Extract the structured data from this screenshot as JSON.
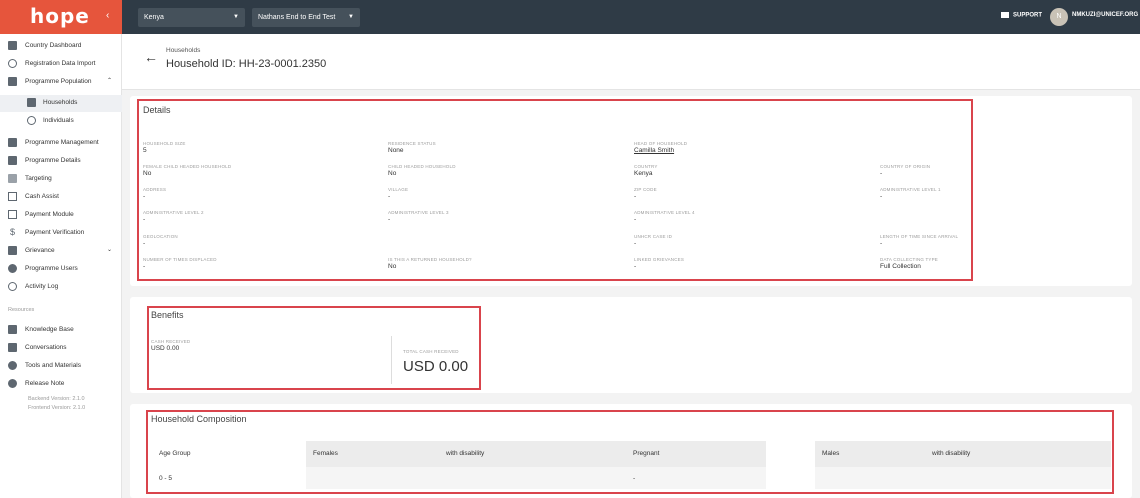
{
  "topbar": {
    "logo": "hope",
    "country": "Kenya",
    "programme": "Nathans End to End Test",
    "support_label": "SUPPORT",
    "avatar_initial": "N",
    "user_email": "NMKUZI@UNICEF.ORG"
  },
  "sidebar": {
    "items": [
      {
        "label": "Country Dashboard"
      },
      {
        "label": "Registration Data Import"
      },
      {
        "label": "Programme Population"
      },
      {
        "label": "Households"
      },
      {
        "label": "Individuals"
      },
      {
        "label": "Programme Management"
      },
      {
        "label": "Programme Details"
      },
      {
        "label": "Targeting"
      },
      {
        "label": "Cash Assist"
      },
      {
        "label": "Payment Module"
      },
      {
        "label": "Payment Verification"
      },
      {
        "label": "Grievance"
      },
      {
        "label": "Programme Users"
      },
      {
        "label": "Activity Log"
      }
    ],
    "resources_label": "Resources",
    "resources": [
      {
        "label": "Knowledge Base"
      },
      {
        "label": "Conversations"
      },
      {
        "label": "Tools and Materials"
      },
      {
        "label": "Release Note"
      }
    ],
    "backend_version": "Backend Version: 2.1.0",
    "frontend_version": "Frontend Version: 2.1.0"
  },
  "header": {
    "breadcrumb": "Households",
    "title": "Household ID: HH-23-0001.2350"
  },
  "details": {
    "title": "Details",
    "household_size": {
      "label": "Household Size",
      "value": "5"
    },
    "residence_status": {
      "label": "Residence Status",
      "value": "None"
    },
    "head_of_household": {
      "label": "Head of Household",
      "value": "Camilla Smith"
    },
    "female_child_headed": {
      "label": "Female Child Headed Household",
      "value": "No"
    },
    "child_headed": {
      "label": "Child Headed Household",
      "value": "No"
    },
    "country": {
      "label": "Country",
      "value": "Kenya"
    },
    "country_of_origin": {
      "label": "Country of Origin",
      "value": "-"
    },
    "address": {
      "label": "Address",
      "value": "-"
    },
    "village": {
      "label": "Village",
      "value": "-"
    },
    "zip_code": {
      "label": "Zip Code",
      "value": "-"
    },
    "admin_level_1": {
      "label": "Administrative Level 1",
      "value": "-"
    },
    "admin_level_2": {
      "label": "Administrative Level 2",
      "value": "-"
    },
    "admin_level_3": {
      "label": "Administrative Level 3",
      "value": "-"
    },
    "admin_level_4": {
      "label": "Administrative Level 4",
      "value": "-"
    },
    "geolocation": {
      "label": "Geolocation",
      "value": "-"
    },
    "unhcr_case_id": {
      "label": "UNHCR Case ID",
      "value": "-"
    },
    "length_of_time": {
      "label": "Length of Time Since Arrival",
      "value": "-"
    },
    "times_displaced": {
      "label": "Number of Times Displaced",
      "value": "-"
    },
    "returnee": {
      "label": "Is this a returned household?",
      "value": "No"
    },
    "linked_grievances": {
      "label": "Linked Grievances",
      "value": "-"
    },
    "data_collecting_type": {
      "label": "Data Collecting Type",
      "value": "Full Collection"
    }
  },
  "benefits": {
    "title": "Benefits",
    "cash_received_label": "Cash Received",
    "cash_received_value": "USD 0.00",
    "total_cash_label": "Total Cash Received",
    "total_cash_value": "USD 0.00"
  },
  "composition": {
    "title": "Household Composition",
    "headers": {
      "age_group": "Age Group",
      "females": "Females",
      "f_disability": "with disability",
      "pregnant": "Pregnant",
      "males": "Males",
      "m_disability": "with disability"
    },
    "rows": [
      {
        "age_group": "0 - 5",
        "pregnant": "-"
      }
    ]
  },
  "colors": {
    "accent": "#e6553c",
    "topbar": "#2f3b46",
    "highlight": "#d9444c"
  }
}
